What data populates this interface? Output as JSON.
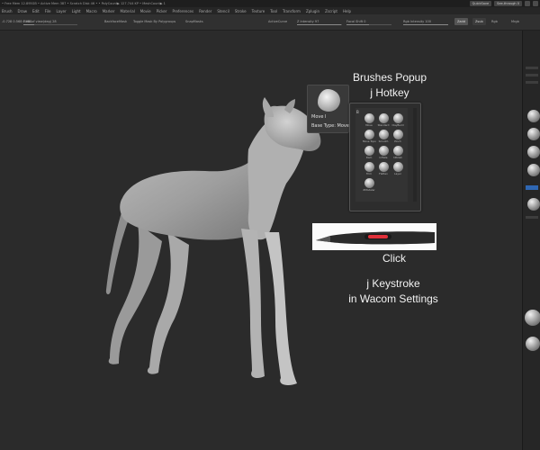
{
  "status_bar": {
    "text": "• Free Mem 12.895GB • Active Mem 387 • Scratch Disk 46 • • PolyCount▶ 127.744 KP • MeshCount▶ 1",
    "quicksave": "QuickSave",
    "see_through": "See-through  0"
  },
  "menu": [
    "Brush",
    "Draw",
    "Edit",
    "File",
    "Layer",
    "Light",
    "Macro",
    "Marker",
    "Material",
    "Movie",
    "Picker",
    "Preferences",
    "Render",
    "Stencil",
    "Stroke",
    "Texture",
    "Tool",
    "Transform",
    "Zplugin",
    "Zscript",
    "Help"
  ],
  "toolbar": {
    "coords": "-0.728 0.568 0.081",
    "fov_label": "Field of view(deg) 28",
    "backface": "BackfaceMask",
    "toggle_mask": "Toggle Mask By Polygroups",
    "snap": "SnapMasks",
    "active_curve": "ActiveCurve",
    "z_intensity": "Z Intensity 97",
    "focal_shift": "Focal Shift 0",
    "rgb_intensity": "Rgb Intensity 100",
    "btn_zadd": "Zadd",
    "btn_zsub": "Zsub",
    "rgb": "Rgb",
    "right_label": "Mrgb"
  },
  "annotations": {
    "popup_title": "Brushes Popup",
    "popup_hotkey": "j Hotkey",
    "click_label": "Click",
    "keystroke_line1": "j Keystroke",
    "keystroke_line2": "in Wacom Settings"
  },
  "brush_preview": {
    "name": "Move  I",
    "base_type": "Base Type: Move"
  },
  "brush_popup": {
    "hotkey_letter": "B",
    "brushes": [
      {
        "label": "Move"
      },
      {
        "label": "Standard"
      },
      {
        "label": "ClayBuild"
      },
      {
        "label": "Move Topo"
      },
      {
        "label": "Smooth"
      },
      {
        "label": "Pinch"
      },
      {
        "label": "Dam"
      },
      {
        "label": "Inflate"
      },
      {
        "label": "hPolish"
      },
      {
        "label": "Trim"
      },
      {
        "label": "Flatten"
      },
      {
        "label": "Layer"
      },
      {
        "label": "ZModeler"
      }
    ]
  },
  "colors": {
    "canvas": "#2b2b2b",
    "pen_button": "#e0313a",
    "accent_blue": "#2f67b3"
  }
}
